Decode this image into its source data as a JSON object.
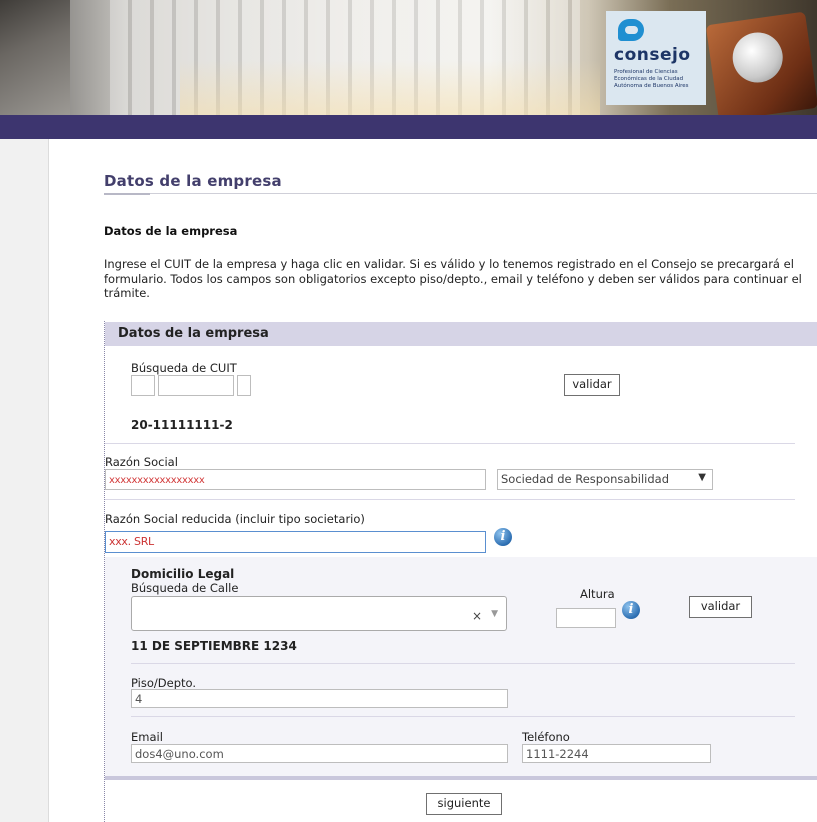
{
  "header": {
    "logo_name": "consejo",
    "logo_subtitle": "Profesional de Ciencias Económicas de la Ciudad Autónoma de Buenos Aires",
    "brand_color": "#3d356f"
  },
  "page": {
    "title": "Datos de la empresa",
    "section_title": "Datos de la empresa",
    "intro": "Ingrese el CUIT de la empresa y haga clic en validar. Si es válido y lo tenemos registrado en el Consejo se precargará el formulario. Todos los campos son obligatorios excepto piso/depto., email y teléfono y deben ser válidos para continuar el trámite."
  },
  "panel": {
    "title": "Datos de la empresa",
    "cuit": {
      "label": "Búsqueda de CUIT",
      "validate_label": "validar",
      "result": "20-11111111-2"
    },
    "razon_social": {
      "label": "Razón Social",
      "value": "xxxxxxxxxxxxxxxxx",
      "tipo_selected": "Sociedad de Responsabilidad",
      "tipo_arrow": "▼"
    },
    "razon_reducida": {
      "label": "Razón Social reducida (incluir tipo societario)",
      "value": "xxx. SRL",
      "info_icon": "info-icon"
    },
    "domicilio": {
      "title": "Domicilio Legal",
      "calle_label": "Búsqueda de Calle",
      "clear_glyph": "×",
      "arrow_glyph": "▼",
      "altura_label": "Altura",
      "altura_value": "",
      "validate_label": "validar",
      "result": "11 DE SEPTIEMBRE 1234",
      "piso_label": "Piso/Depto.",
      "piso_value": "4",
      "email_label": "Email",
      "email_value": "dos4@uno.com",
      "telefono_label": "Teléfono",
      "telefono_value": "1111-2244"
    },
    "next_label": "siguiente"
  }
}
